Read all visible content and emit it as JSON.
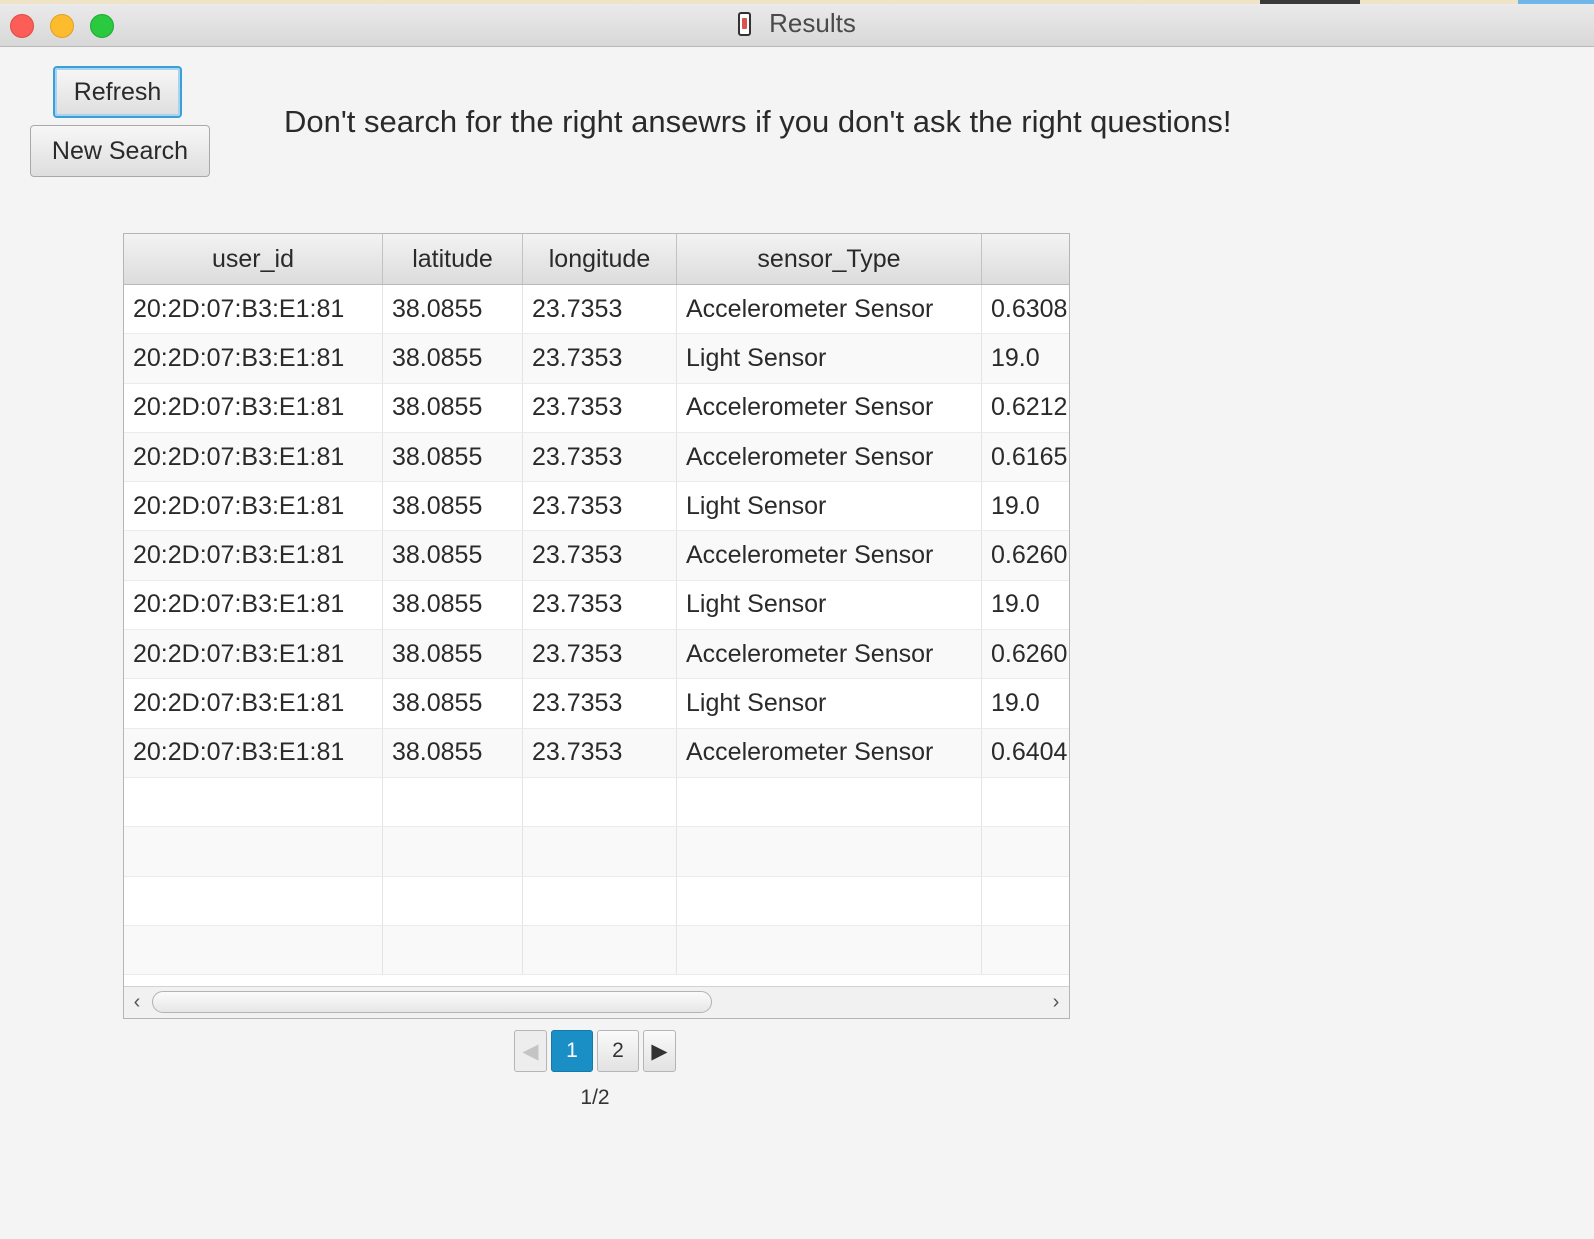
{
  "window": {
    "title": "Results",
    "app_icon": "phone-icon"
  },
  "toolbar": {
    "refresh_label": "Refresh",
    "new_search_label": "New Search"
  },
  "quote": "Don't search for the right ansewrs if you don't ask the right questions!",
  "table": {
    "columns": [
      "user_id",
      "latitude",
      "longitude",
      "sensor_Type",
      ""
    ],
    "rows": [
      [
        "20:2D:07:B3:E1:81",
        "38.0855",
        "23.7353",
        "Accelerometer Sensor",
        "0.6308"
      ],
      [
        "20:2D:07:B3:E1:81",
        "38.0855",
        "23.7353",
        "Light Sensor",
        "19.0"
      ],
      [
        "20:2D:07:B3:E1:81",
        "38.0855",
        "23.7353",
        "Accelerometer Sensor",
        "0.6212"
      ],
      [
        "20:2D:07:B3:E1:81",
        "38.0855",
        "23.7353",
        "Accelerometer Sensor",
        "0.6165"
      ],
      [
        "20:2D:07:B3:E1:81",
        "38.0855",
        "23.7353",
        "Light Sensor",
        "19.0"
      ],
      [
        "20:2D:07:B3:E1:81",
        "38.0855",
        "23.7353",
        "Accelerometer Sensor",
        "0.6260"
      ],
      [
        "20:2D:07:B3:E1:81",
        "38.0855",
        "23.7353",
        "Light Sensor",
        "19.0"
      ],
      [
        "20:2D:07:B3:E1:81",
        "38.0855",
        "23.7353",
        "Accelerometer Sensor",
        "0.6260"
      ],
      [
        "20:2D:07:B3:E1:81",
        "38.0855",
        "23.7353",
        "Light Sensor",
        "19.0"
      ],
      [
        "20:2D:07:B3:E1:81",
        "38.0855",
        "23.7353",
        "Accelerometer Sensor",
        "0.6404"
      ]
    ]
  },
  "scrollbar": {
    "left_icon": "chevron-left-icon",
    "right_icon": "chevron-right-icon"
  },
  "pagination": {
    "prev_icon": "triangle-left-icon",
    "next_icon": "triangle-right-icon",
    "pages": [
      "1",
      "2"
    ],
    "current": "1",
    "info": "1/2"
  },
  "colors": {
    "accent": "#1a8fc6",
    "focus_ring": "#3aa0d8"
  }
}
